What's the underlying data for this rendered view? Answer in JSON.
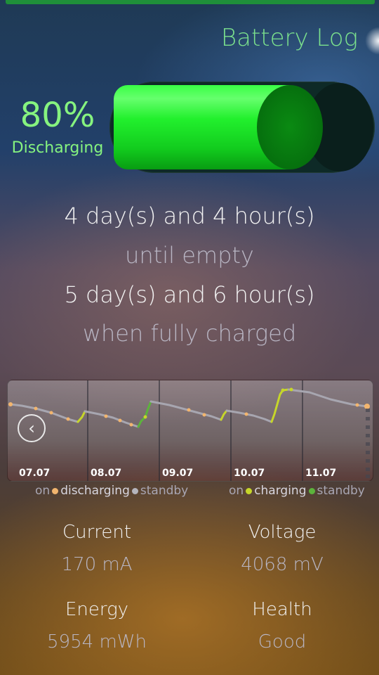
{
  "app": {
    "title": "Battery Log"
  },
  "battery": {
    "percent_label": "80%",
    "level": 0.8,
    "status": "Discharging"
  },
  "estimates": {
    "time_until_empty": "4 day(s) and 4 hour(s)",
    "until_empty_label": "until empty",
    "time_when_full": "5 day(s) and 6 hour(s)",
    "when_full_label": "when fully charged"
  },
  "graph": {
    "dates": [
      "07.07",
      "08.07",
      "09.07",
      "10.07",
      "11.07"
    ],
    "legend": {
      "discharging_on": "on",
      "discharging": "discharging",
      "discharging_standby": "standby",
      "charging_on": "on",
      "charging": "charging",
      "charging_standby": "standby"
    },
    "colors": {
      "discharging_on": "#f2b56e",
      "discharging_standby": "#b5b5bd",
      "charging_on": "#c6d62a",
      "charging_standby": "#5cb33c",
      "graph_line": "#a7a6b0"
    }
  },
  "stats": {
    "current": {
      "label": "Current",
      "value": "170 mA"
    },
    "voltage": {
      "label": "Voltage",
      "value": "4068 mV"
    },
    "energy": {
      "label": "Energy",
      "value": "5954 mWh"
    },
    "health": {
      "label": "Health",
      "value": "Good"
    }
  },
  "colors": {
    "accent": "#7be08d",
    "battery_fill": "#22f02d",
    "top_bar": "#1f8f3a"
  }
}
